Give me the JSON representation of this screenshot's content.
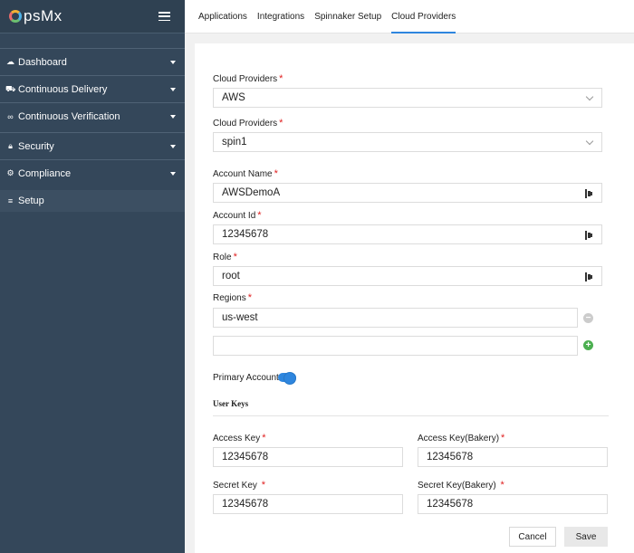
{
  "brand": {
    "logo_text": "psMx"
  },
  "sidebar": {
    "items": [
      {
        "label": "Dashboard",
        "icon": "cloud-icon"
      },
      {
        "label": "Continuous Delivery",
        "icon": "truck-icon"
      },
      {
        "label": "Continuous Verification",
        "icon": "glasses-icon"
      },
      {
        "label": "Security",
        "icon": "lock-icon"
      },
      {
        "label": "Compliance",
        "icon": "gear-icon"
      },
      {
        "label": "Setup",
        "icon": "list-icon"
      }
    ]
  },
  "tabs": [
    {
      "label": "Applications"
    },
    {
      "label": "Integrations"
    },
    {
      "label": "Spinnaker Setup"
    },
    {
      "label": "Cloud Providers",
      "active": true
    }
  ],
  "form": {
    "cloud_provider": {
      "label": "Cloud Providers",
      "value": "AWS"
    },
    "cloud_provider_2": {
      "label": "Cloud Providers",
      "value": "spin1"
    },
    "account_name": {
      "label": "Account Name",
      "value": "AWSDemoA"
    },
    "account_id": {
      "label": "Account Id",
      "value": "12345678"
    },
    "role": {
      "label": "Role",
      "value": "root"
    },
    "regions": {
      "label": "Regions",
      "values": [
        "us-west",
        ""
      ]
    },
    "primary_account": {
      "label": "Primary Account",
      "enabled": true
    },
    "user_keys_title": "User Keys",
    "access_key": {
      "label": "Access Key",
      "value": "12345678"
    },
    "access_key_bakery": {
      "label": "Access Key(Bakery)",
      "value": "12345678"
    },
    "secret_key": {
      "label": "Secret Key",
      "value": "12345678"
    },
    "secret_key_bakery": {
      "label": "Secret Key(Bakery)",
      "value": "12345678"
    },
    "required_mark": "*",
    "cancel_label": "Cancel",
    "save_label": "Save"
  },
  "colors": {
    "sidebar": "#34475a",
    "accent": "#2e86de",
    "required": "#e02020",
    "add": "#4caf50",
    "remove": "#cccccc"
  }
}
